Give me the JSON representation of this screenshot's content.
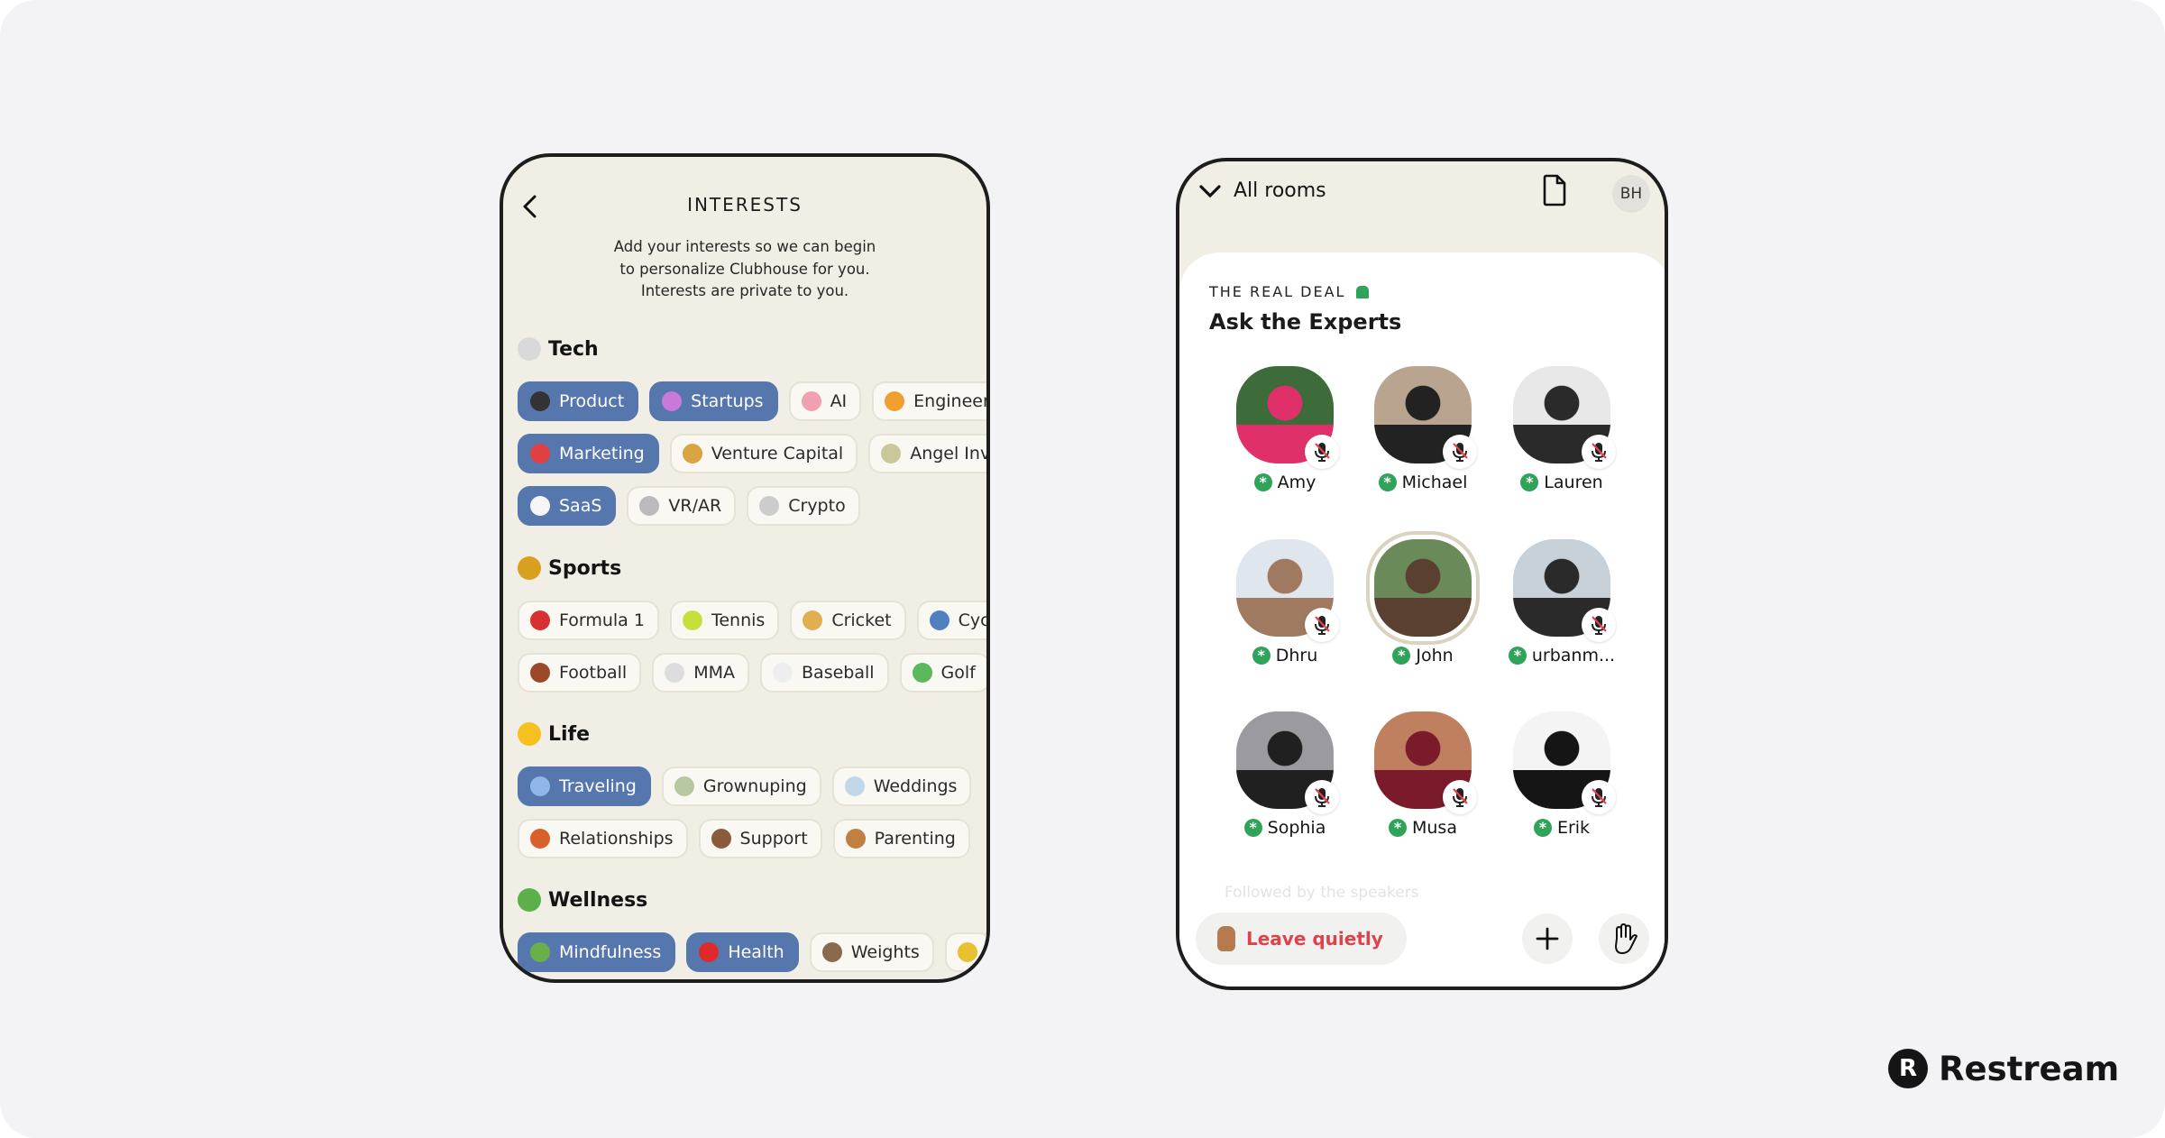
{
  "interests": {
    "title": "INTERESTS",
    "description": [
      "Add your interests so we can begin",
      "to personalize Clubhouse for you.",
      "Interests are private to you."
    ],
    "sections": [
      {
        "name": "Tech",
        "icon": "compass-icon",
        "icon_color": "#d9d9d9",
        "rows": [
          [
            {
              "label": "Product",
              "icon": "mobile-phone-icon",
              "color": "#333333",
              "selected": true
            },
            {
              "label": "Startups",
              "icon": "unicorn-icon",
              "color": "#c77ad9",
              "selected": true
            },
            {
              "label": "AI",
              "icon": "brain-icon",
              "color": "#f0a0b0",
              "selected": false
            },
            {
              "label": "Engineer",
              "icon": "pizza-icon",
              "color": "#f0a030",
              "selected": false
            }
          ],
          [
            {
              "label": "Marketing",
              "icon": "chart-increasing-icon",
              "color": "#e04040",
              "selected": true
            },
            {
              "label": "Venture Capital",
              "icon": "money-bag-icon",
              "color": "#d9a441",
              "selected": false
            },
            {
              "label": "Angel Inv",
              "icon": "banknote-icon",
              "color": "#c8c89a",
              "selected": false
            }
          ],
          [
            {
              "label": "SaaS",
              "icon": "cloud-icon",
              "color": "#f5f5f5",
              "selected": true
            },
            {
              "label": "VR/AR",
              "icon": "goggles-icon",
              "color": "#bbbbbb",
              "selected": false
            },
            {
              "label": "Crypto",
              "icon": "rabbit-icon",
              "color": "#cccccc",
              "selected": false
            }
          ]
        ]
      },
      {
        "name": "Sports",
        "icon": "trophy-icon",
        "icon_color": "#d9a020",
        "rows": [
          [
            {
              "label": "Formula 1",
              "icon": "racing-car-icon",
              "color": "#d83030",
              "selected": false
            },
            {
              "label": "Tennis",
              "icon": "tennis-ball-icon",
              "color": "#c5e03a",
              "selected": false
            },
            {
              "label": "Cricket",
              "icon": "cricket-icon",
              "color": "#e0b050",
              "selected": false
            },
            {
              "label": "Cyc",
              "icon": "bicycle-icon",
              "color": "#5080c0",
              "selected": false
            }
          ],
          [
            {
              "label": "Football",
              "icon": "football-icon",
              "color": "#9a4a28",
              "selected": false
            },
            {
              "label": "MMA",
              "icon": "martial-arts-uniform-icon",
              "color": "#dddddd",
              "selected": false
            },
            {
              "label": "Baseball",
              "icon": "baseball-icon",
              "color": "#eeeeee",
              "selected": false
            },
            {
              "label": "Golf",
              "icon": "golf-flag-icon",
              "color": "#5cb85c",
              "selected": false
            }
          ]
        ]
      },
      {
        "name": "Life",
        "icon": "sunflower-icon",
        "icon_color": "#f5c020",
        "rows": [
          [
            {
              "label": "Traveling",
              "icon": "airplane-icon",
              "color": "#8fb8e8",
              "selected": true
            },
            {
              "label": "Grownuping",
              "icon": "money-wings-icon",
              "color": "#b8c8a0",
              "selected": false
            },
            {
              "label": "Weddings",
              "icon": "ring-icon",
              "color": "#c0d8e8",
              "selected": false
            }
          ],
          [
            {
              "label": "Relationships",
              "icon": "yarn-icon",
              "color": "#d9602a",
              "selected": false
            },
            {
              "label": "Support",
              "icon": "coffee-icon",
              "color": "#8a5a3a",
              "selected": false
            },
            {
              "label": "Parenting",
              "icon": "teddy-bear-icon",
              "color": "#c08040",
              "selected": false
            }
          ]
        ]
      },
      {
        "name": "Wellness",
        "icon": "herb-icon",
        "icon_color": "#5cb04a",
        "rows": [
          [
            {
              "label": "Mindfulness",
              "icon": "leaf-wind-icon",
              "color": "#6ab04a",
              "selected": true
            },
            {
              "label": "Health",
              "icon": "apple-icon",
              "color": "#e02a2a",
              "selected": true
            },
            {
              "label": "Weights",
              "icon": "weightlifter-icon",
              "color": "#8a6a4a",
              "selected": false
            },
            {
              "label": "",
              "icon": "corn-icon",
              "color": "#e8c030",
              "selected": false
            }
          ]
        ]
      }
    ]
  },
  "room": {
    "header": {
      "all_rooms": "All rooms",
      "avatar_initials": "BH"
    },
    "club": "THE REAL DEAL",
    "title": "Ask the Experts",
    "speakers": [
      {
        "name": "Amy",
        "colors": [
          "#3d6b3a",
          "#e0306a"
        ],
        "muted": true,
        "speaking": false
      },
      {
        "name": "Michael",
        "colors": [
          "#b9a58f",
          "#222222"
        ],
        "muted": true,
        "speaking": false
      },
      {
        "name": "Lauren",
        "colors": [
          "#e8e8e8",
          "#2a2a2a"
        ],
        "muted": true,
        "speaking": false
      },
      {
        "name": "Dhru",
        "colors": [
          "#dfe6ee",
          "#a07a60"
        ],
        "muted": true,
        "speaking": false
      },
      {
        "name": "John",
        "colors": [
          "#6a8a5a",
          "#5a4030"
        ],
        "muted": false,
        "speaking": true
      },
      {
        "name": "urbanm...",
        "colors": [
          "#c8d0d8",
          "#2a2a2a"
        ],
        "muted": true,
        "speaking": false
      },
      {
        "name": "Sophia",
        "colors": [
          "#9a9aa0",
          "#202020"
        ],
        "muted": true,
        "speaking": false
      },
      {
        "name": "Musa",
        "colors": [
          "#c08060",
          "#7a1a2a"
        ],
        "muted": true,
        "speaking": false
      },
      {
        "name": "Erik",
        "colors": [
          "#f4f4f4",
          "#151515"
        ],
        "muted": true,
        "speaking": false
      }
    ],
    "followed_label": "Followed by the speakers",
    "leave_label": "Leave quietly"
  },
  "brand": {
    "logo_text": "Restream",
    "logo_letter": "R"
  },
  "colors": {
    "selected_chip": "#5677ad",
    "phone_bg": "#f1efe5",
    "moderator_badge": "#2fa35a",
    "leave_text": "#e0424b"
  }
}
